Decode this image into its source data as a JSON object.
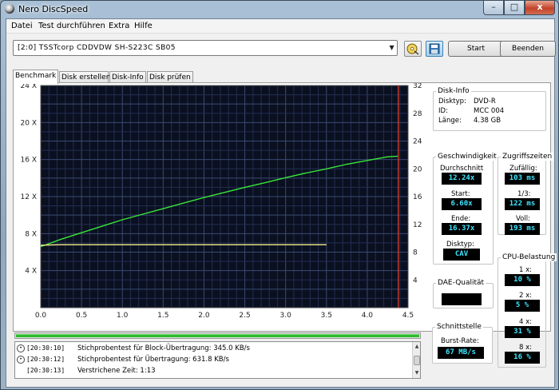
{
  "window": {
    "title": "Nero DiscSpeed",
    "minimize": "–",
    "maximize": "□",
    "close": "x"
  },
  "menu": [
    "Datei",
    "Test durchführen",
    "Extra",
    "Hilfe"
  ],
  "toolbar": {
    "drive": "[2:0]  TSSTcorp CDDVDW SH-S223C SB05",
    "start": "Start",
    "end": "Beenden"
  },
  "tabs": [
    "Benchmark",
    "Disk erstellen",
    "Disk-Info",
    "Disk prüfen"
  ],
  "disk_info": {
    "title": "Disk-Info",
    "rows": [
      {
        "label": "Disktyp:",
        "value": "DVD-R"
      },
      {
        "label": "ID:",
        "value": "MCC 004"
      },
      {
        "label": "Länge:",
        "value": "4.38 GB"
      }
    ]
  },
  "speed": {
    "title": "Geschwindigkeit",
    "avg_label": "Durchschnitt",
    "avg": "12.24x",
    "start_label": "Start:",
    "start": "6.60x",
    "end_label": "Ende:",
    "end": "16.37x",
    "disktype_label": "Disktyp:",
    "disktype": "CAV"
  },
  "access": {
    "title": "Zugriffszeiten",
    "random_label": "Zufällig:",
    "random": "103 ms",
    "third_label": "1/3:",
    "third": "122 ms",
    "full_label": "Voll:",
    "full": "193 ms"
  },
  "cpu": {
    "title": "CPU-Belastung",
    "rows": [
      {
        "label": "1 x:",
        "value": "10 %"
      },
      {
        "label": "2 x:",
        "value": "5 %"
      },
      {
        "label": "4 x:",
        "value": "31 %"
      },
      {
        "label": "8 x:",
        "value": "16 %"
      }
    ]
  },
  "dae": {
    "title": "DAE-Qualität",
    "value": ""
  },
  "interface": {
    "title": "Schnittstelle",
    "burst_label": "Burst-Rate:",
    "burst": "67 MB/s"
  },
  "progress": 1.0,
  "log": [
    {
      "time": "[20:30:10]",
      "msg": "Stichprobentest für Block-Übertragung: 345.0 KB/s"
    },
    {
      "time": "[20:30:12]",
      "msg": "Stichprobentest für Übertragung: 631.8 KB/s"
    },
    {
      "time": "[20:30:13]",
      "msg": "Verstrichene Zeit: 1:13"
    }
  ],
  "chart_data": {
    "type": "line",
    "x_ticks": [
      "0.0",
      "0.5",
      "1.0",
      "1.5",
      "2.0",
      "2.5",
      "3.0",
      "3.5",
      "4.0",
      "4.5"
    ],
    "xlim": [
      0,
      4.5
    ],
    "y_left_ticks": [
      "4 X",
      "8 X",
      "12 X",
      "16 X",
      "20 X",
      "24 X"
    ],
    "ylim_left": [
      0,
      24
    ],
    "y_right_ticks": [
      "4",
      "8",
      "12",
      "16",
      "20",
      "24",
      "28",
      "32"
    ],
    "ylim_right": [
      0,
      32
    ],
    "grid": true,
    "background": "#0a1020",
    "series": [
      {
        "color": "#39e639",
        "x": [
          0.0,
          0.25,
          0.5,
          0.75,
          1.0,
          1.25,
          1.5,
          1.75,
          2.0,
          2.25,
          2.5,
          2.75,
          3.0,
          3.25,
          3.5,
          3.75,
          4.0,
          4.25,
          4.38
        ],
        "y": [
          6.6,
          7.4,
          8.1,
          8.8,
          9.5,
          10.1,
          10.7,
          11.3,
          11.9,
          12.45,
          13.0,
          13.5,
          14.05,
          14.55,
          15.0,
          15.5,
          15.9,
          16.3,
          16.37
        ]
      },
      {
        "color": "#f5f08a",
        "x": [
          0.0,
          0.25,
          0.5,
          0.75,
          1.0,
          1.25,
          1.5,
          1.75,
          2.0,
          2.25,
          2.5,
          2.75,
          3.0,
          3.25,
          3.5
        ],
        "y": [
          6.75,
          6.8,
          6.8,
          6.8,
          6.8,
          6.8,
          6.8,
          6.8,
          6.8,
          6.8,
          6.8,
          6.8,
          6.8,
          6.8,
          6.8
        ]
      }
    ],
    "marker_x": 4.38,
    "marker_color": "#c0392b"
  }
}
